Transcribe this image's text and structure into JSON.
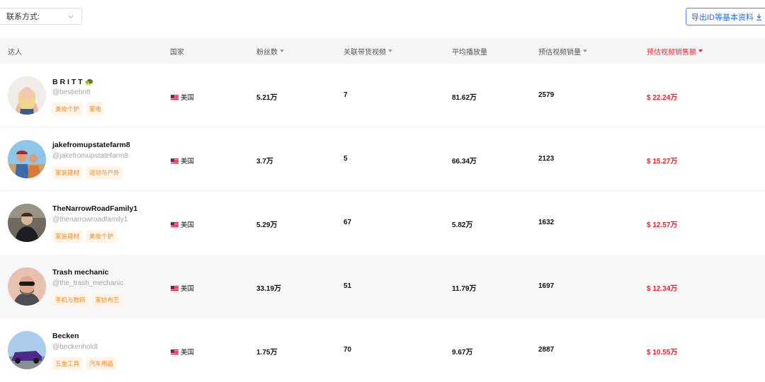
{
  "filter": {
    "label": "联系方式:"
  },
  "export_button": {
    "label": "导出ID等基本资料"
  },
  "columns": [
    {
      "key": "creator",
      "label": "达人",
      "sortable": false
    },
    {
      "key": "country",
      "label": "国家",
      "sortable": false
    },
    {
      "key": "followers",
      "label": "粉丝数",
      "sortable": true
    },
    {
      "key": "linked_videos",
      "label": "关联带货视频",
      "sortable": true
    },
    {
      "key": "avg_views",
      "label": "平均播放量",
      "sortable": false
    },
    {
      "key": "est_sales",
      "label": "预估视频销量",
      "sortable": true
    },
    {
      "key": "est_revenue",
      "label": "预估视频销售额",
      "sortable": true,
      "active": true
    }
  ],
  "rows": [
    {
      "name": "B R I T T 🐢",
      "handle": "@bestiebritt",
      "tags": [
        "美妆个护",
        "家电"
      ],
      "country": "美国",
      "followers": "5.21万",
      "linked_videos": "7",
      "avg_views": "81.62万",
      "est_sales": "2579",
      "est_revenue": "$ 22.24万"
    },
    {
      "name": "jakefromupstatefarm8",
      "handle": "@jakefromupstatefarm8",
      "tags": [
        "家装建材",
        "运动与户外"
      ],
      "country": "美国",
      "followers": "3.7万",
      "linked_videos": "5",
      "avg_views": "66.34万",
      "est_sales": "2123",
      "est_revenue": "$ 15.27万"
    },
    {
      "name": "TheNarrowRoadFamily1",
      "handle": "@thenarrowroadfamily1",
      "tags": [
        "家装建材",
        "美妆个护"
      ],
      "country": "美国",
      "followers": "5.29万",
      "linked_videos": "67",
      "avg_views": "5.82万",
      "est_sales": "1632",
      "est_revenue": "$ 12.57万"
    },
    {
      "name": "Trash mechanic",
      "handle": "@the_trash_mechanic",
      "tags": [
        "手机与数码",
        "家纺布艺"
      ],
      "country": "美国",
      "followers": "33.19万",
      "linked_videos": "51",
      "avg_views": "11.79万",
      "est_sales": "1697",
      "est_revenue": "$ 12.34万"
    },
    {
      "name": "Becken",
      "handle": "@beckenholdt",
      "tags": [
        "五金工具",
        "汽车用品"
      ],
      "country": "美国",
      "followers": "1.75万",
      "linked_videos": "70",
      "avg_views": "9.67万",
      "est_sales": "2887",
      "est_revenue": "$ 10.55万"
    }
  ],
  "colors": {
    "accent_blue": "#2d6cdf",
    "revenue_red": "#f5222d",
    "tag_orange": "#f08a24"
  }
}
